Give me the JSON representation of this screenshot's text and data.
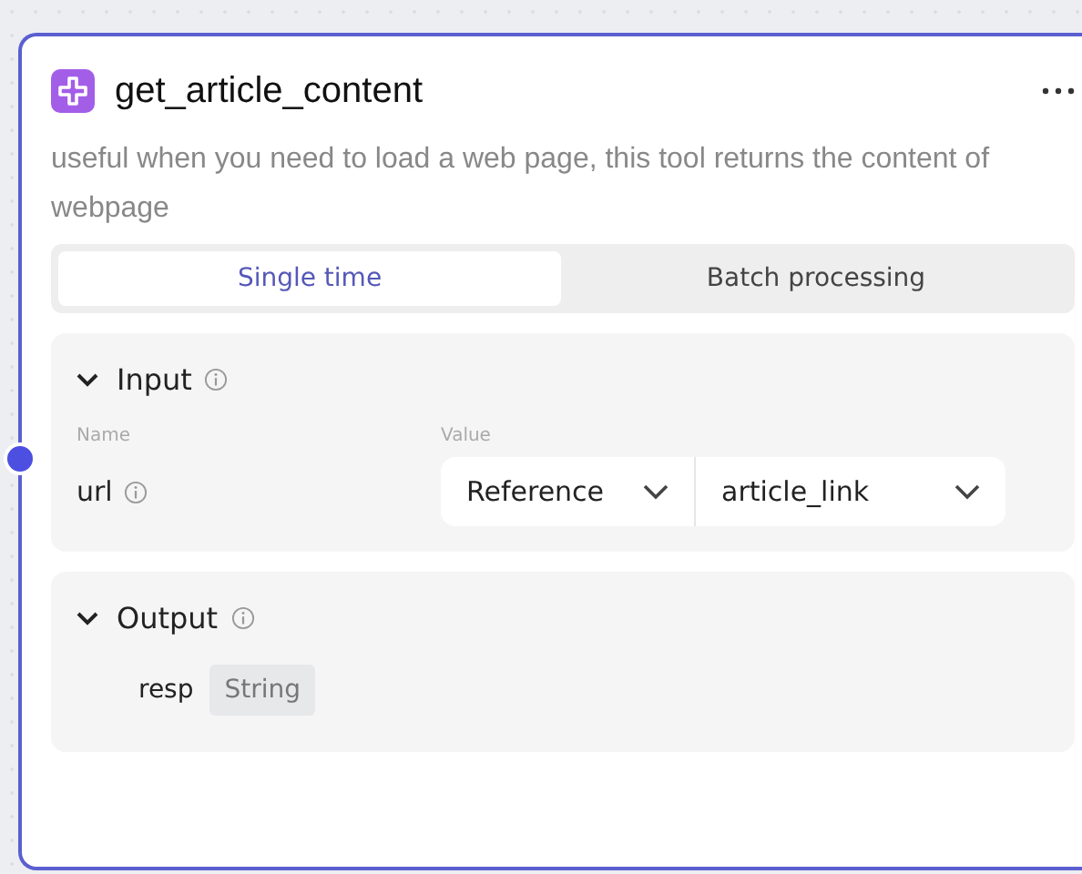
{
  "node": {
    "title": "get_article_content",
    "description": "useful when you need to load a web page, this tool returns the content of webpage"
  },
  "tabs": [
    {
      "label": "Single time",
      "selected": true
    },
    {
      "label": "Batch processing",
      "selected": false
    }
  ],
  "input": {
    "title": "Input",
    "expanded": true,
    "name_header": "Name",
    "value_header": "Value",
    "params": [
      {
        "name": "url",
        "source": "Reference",
        "value": "article_link"
      }
    ]
  },
  "output": {
    "title": "Output",
    "expanded": true,
    "fields": [
      {
        "name": "resp",
        "type": "String"
      }
    ]
  }
}
